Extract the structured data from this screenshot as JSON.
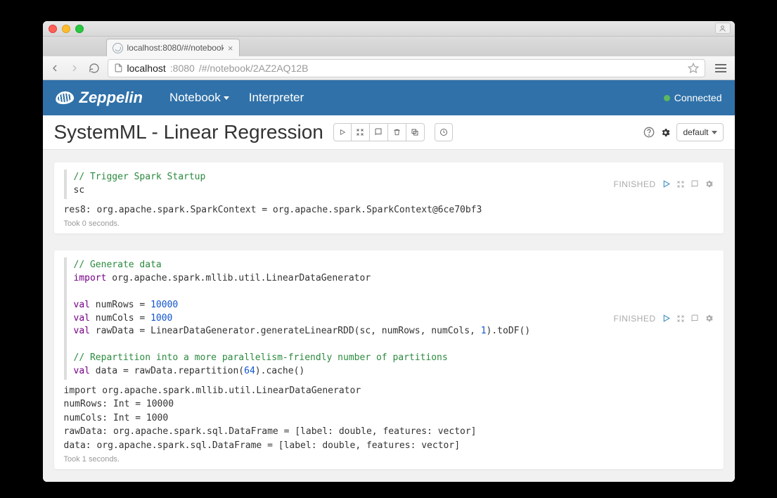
{
  "browser": {
    "tabTitle": "localhost:8080/#/notebook",
    "url_host": "localhost",
    "url_port": ":8080",
    "url_path": "/#/notebook/2AZ2AQ12B"
  },
  "header": {
    "brand": "Zeppelin",
    "nav_notebook": "Notebook",
    "nav_interpreter": "Interpreter",
    "status": "Connected"
  },
  "notebook": {
    "title": "SystemML - Linear Regression",
    "defaultLabel": "default"
  },
  "cell1": {
    "status": "FINISHED",
    "comment": "// Trigger Spark Startup",
    "code": "sc",
    "output": "res8: org.apache.spark.SparkContext = org.apache.spark.SparkContext@6ce70bf3",
    "took": "Took 0 seconds."
  },
  "cell2": {
    "status": "FINISHED",
    "comment1": "// Generate data",
    "kw_import": "import",
    "importPkg": " org.apache.spark.mllib.util.LinearDataGenerator",
    "kw_val": "val",
    "l1a": " numRows = ",
    "l1n": "10000",
    "l2a": " numCols = ",
    "l2n": "1000",
    "l3a": " rawData = LinearDataGenerator.generateLinearRDD(sc, numRows, numCols, ",
    "l3n": "1",
    "l3b": ").toDF()",
    "comment2": "// Repartition into a more parallelism-friendly number of partitions",
    "l4a": " data = rawData.repartition(",
    "l4n": "64",
    "l4b": ").cache()",
    "out1": "import org.apache.spark.mllib.util.LinearDataGenerator",
    "out2": "numRows: Int = 10000",
    "out3": "numCols: Int = 1000",
    "out4": "rawData: org.apache.spark.sql.DataFrame = [label: double, features: vector]",
    "out5": "data: org.apache.spark.sql.DataFrame = [label: double, features: vector]",
    "took": "Took 1 seconds."
  }
}
